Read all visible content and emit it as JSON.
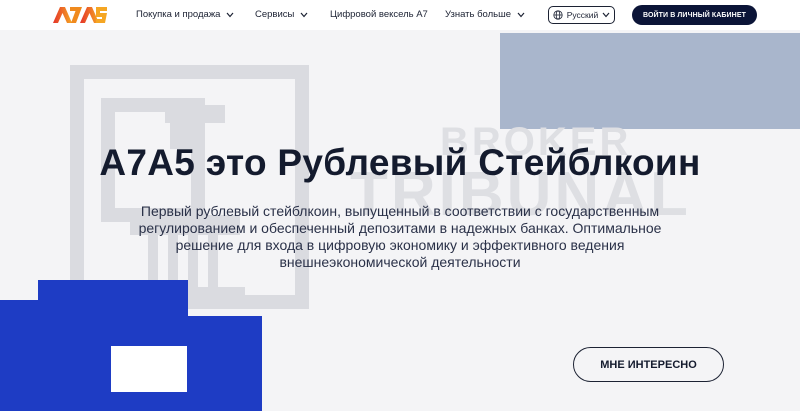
{
  "header": {
    "logo_text": "A7A5",
    "nav": [
      {
        "label": "Покупка и продажа",
        "has_dropdown": true
      },
      {
        "label": "Сервисы",
        "has_dropdown": true
      },
      {
        "label": "Цифровой вексель A7",
        "has_dropdown": false
      },
      {
        "label": "Узнать больше",
        "has_dropdown": true
      }
    ],
    "language": "Русский",
    "login_label": "ВОЙТИ В ЛИЧНЫЙ КАБИНЕТ"
  },
  "watermark": {
    "line1": "BROKER",
    "line2": "TRIBUNAL"
  },
  "hero": {
    "title": "A7A5 это Рублевый Стейблкоин",
    "subtitle_lines": [
      "Первый рублевый стейблкоин, выпущенный в соответствии с государственным",
      "регулированием и обеспеченный депозитами в надежных банках. Оптимальное",
      "решение для входа в цифровую экономику и эффективного ведения",
      "внешнеэкономической деятельности"
    ],
    "cta_label": "МНЕ ИНТЕРЕСНО"
  },
  "colors": {
    "brand_orange": "#f08a1e",
    "brand_red": "#e5332a",
    "navy": "#0b1437",
    "deco_blue": "#1e3cc4",
    "deco_grey_blue": "#a9b6cc"
  }
}
